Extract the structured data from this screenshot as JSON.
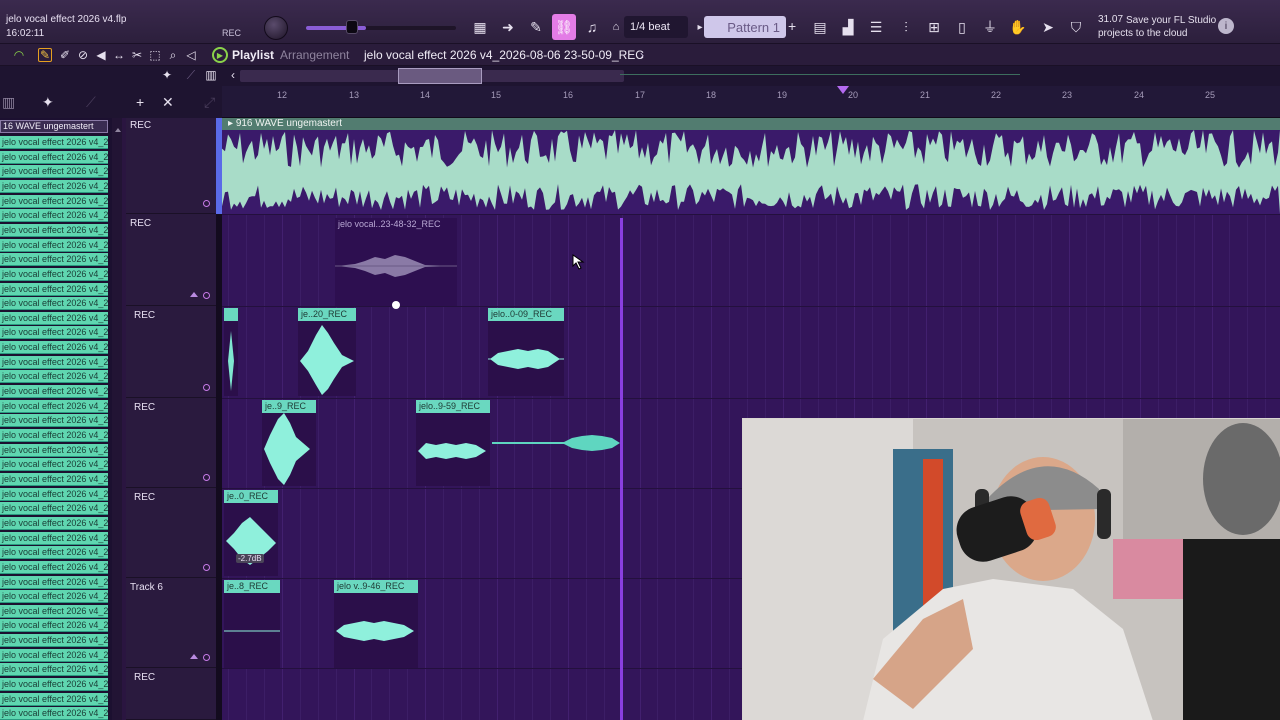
{
  "project": {
    "filename": "jelo vocal effect 2026 v4.flp",
    "clock": "16:02:11",
    "rec_label": "REC"
  },
  "toolbar": {
    "snap": "1/4 beat",
    "pattern": "Pattern 1",
    "pattern_add": "+",
    "hint_number": "31.07",
    "hint_text": "Save your FL Studio projects to the cloud"
  },
  "playlist": {
    "title": "Playlist",
    "subtitle": "Arrangement",
    "file": "jelo vocal effect 2026 v4_2026-08-06 23-50-09_REC",
    "arrow": "›"
  },
  "ruler": {
    "bars": [
      "12",
      "13",
      "14",
      "15",
      "16",
      "17",
      "18",
      "19",
      "20",
      "21",
      "22",
      "23",
      "24",
      "25"
    ]
  },
  "browser": {
    "header": "16 WAVE ungemastert",
    "item_label": "jelo vocal effect 2026 v4_2"
  },
  "tracks": [
    {
      "label": "REC"
    },
    {
      "label": "REC"
    },
    {
      "label": "REC"
    },
    {
      "label": "REC"
    },
    {
      "label": "REC"
    },
    {
      "label": "Track 6"
    },
    {
      "label": "REC"
    }
  ],
  "clips": {
    "master": "916 WAVE ungemastert",
    "ghost": "jelo vocal..23-48-32_REC",
    "c_r2a": "",
    "c_r2b": "je..20_REC",
    "c_r2c": "jelo..0-09_REC",
    "c_r3a": "je..9_REC",
    "c_r3b": "jelo..9-59_REC",
    "c_r4a": "je..0_REC",
    "c_r4_db": "-2.7dB",
    "c_r5a": "je..8_REC",
    "c_r5b": "jelo v..9-46_REC"
  },
  "colors": {
    "accent": "#e37ce6",
    "clip": "#6ad8c0",
    "playhead": "#8a3fe0",
    "arrangement_bg": "#33155a"
  }
}
